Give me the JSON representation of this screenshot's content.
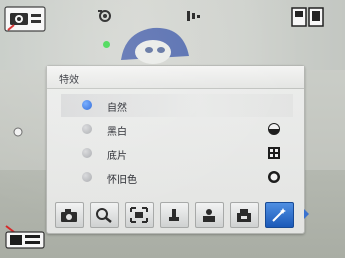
{
  "menu": {
    "title": "特效",
    "options": [
      {
        "label": "自然",
        "selected": true,
        "icon": "none"
      },
      {
        "label": "黑白",
        "selected": false,
        "icon": "bw-effect-icon"
      },
      {
        "label": "底片",
        "selected": false,
        "icon": "negative-effect-icon"
      },
      {
        "label": "怀旧色",
        "selected": false,
        "icon": "sepia-effect-icon"
      }
    ]
  },
  "toolbar": {
    "items": [
      {
        "name": "camera-mode-tool"
      },
      {
        "name": "zoom-tool"
      },
      {
        "name": "frame-tool"
      },
      {
        "name": "exposure-tool"
      },
      {
        "name": "scene-tool"
      },
      {
        "name": "quality-tool"
      },
      {
        "name": "effects-tool",
        "active": true
      }
    ]
  },
  "colors": {
    "accent": "#1f5fd6",
    "record_indicator": "#3bd64a"
  }
}
